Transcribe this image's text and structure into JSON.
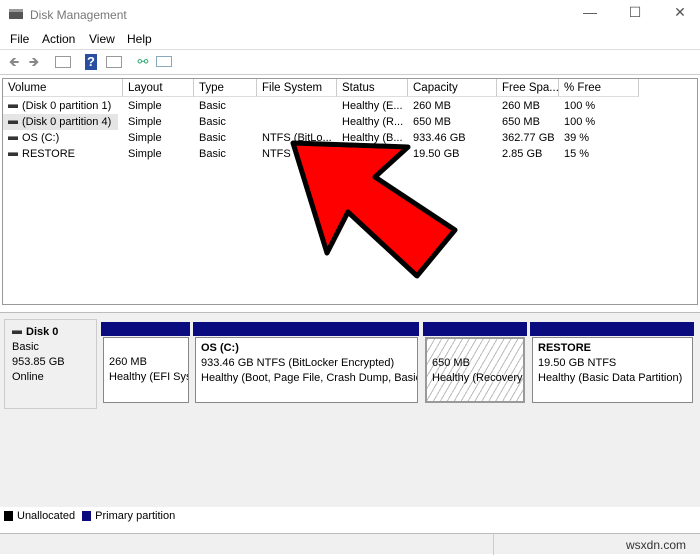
{
  "window": {
    "title": "Disk Management"
  },
  "menu": [
    "File",
    "Action",
    "View",
    "Help"
  ],
  "toolbar": {
    "icons": [
      "back-arrow-icon",
      "forward-arrow-icon",
      "console-tree-icon",
      "help-icon",
      "action-pane-icon",
      "connect-icon",
      "properties-icon"
    ]
  },
  "volumes": {
    "headers": [
      "Volume",
      "Layout",
      "Type",
      "File System",
      "Status",
      "Capacity",
      "Free Spa...",
      "% Free"
    ],
    "rows": [
      [
        "(Disk 0 partition 1)",
        "Simple",
        "Basic",
        "",
        "Healthy (E...",
        "260 MB",
        "260 MB",
        "100 %"
      ],
      [
        "(Disk 0 partition 4)",
        "Simple",
        "Basic",
        "",
        "Healthy (R...",
        "650 MB",
        "650 MB",
        "100 %"
      ],
      [
        "OS (C:)",
        "Simple",
        "Basic",
        "NTFS (BitLo...",
        "Healthy (B...",
        "933.46 GB",
        "362.77 GB",
        "39 %"
      ],
      [
        "RESTORE",
        "Simple",
        "Basic",
        "NTFS",
        "",
        "19.50 GB",
        "2.85 GB",
        "15 %"
      ]
    ]
  },
  "disk": {
    "name": "Disk 0",
    "type": "Basic",
    "size": "953.85 GB",
    "state": "Online",
    "partitions": [
      {
        "name": "",
        "line1": "260 MB",
        "line2": "Healthy (EFI Sys"
      },
      {
        "name": "OS  (C:)",
        "line1": "933.46 GB NTFS (BitLocker Encrypted)",
        "line2": "Healthy (Boot, Page File, Crash Dump, Basic"
      },
      {
        "name": "",
        "line1": "650 MB",
        "line2": "Healthy (Recovery"
      },
      {
        "name": "RESTORE",
        "line1": "19.50 GB NTFS",
        "line2": "Healthy (Basic Data Partition)"
      }
    ]
  },
  "legend": [
    {
      "label": "Unallocated",
      "color": "#000000"
    },
    {
      "label": "Primary partition",
      "color": "#0b0b80"
    }
  ],
  "watermark": "wsxdn.com",
  "annotation": {
    "color": "#ff0000"
  }
}
